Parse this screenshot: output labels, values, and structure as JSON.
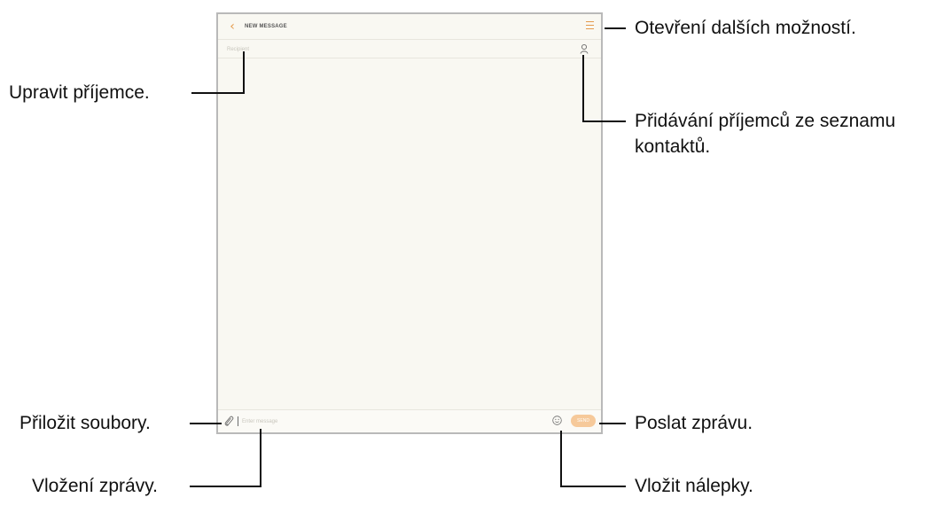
{
  "app": {
    "title": "NEW MESSAGE",
    "recipient_placeholder": "Recipient",
    "message_placeholder": "Enter message",
    "send_label": "SEND",
    "accent_color": "#e49a4c",
    "send_color": "#f6c99a"
  },
  "icons": {
    "back": "chevron-left",
    "more": "more-options",
    "contacts": "person",
    "attach": "paperclip",
    "sticker": "smiley"
  },
  "callouts": {
    "more_options": "Otevření dalších možností.",
    "edit_recipients": "Upravit příjemce.",
    "add_contacts_line1": "Přidávání příjemců ze seznamu",
    "add_contacts_line2": "kontaktů.",
    "attach_files": "Přiložit soubory.",
    "send_message": "Poslat zprávu.",
    "enter_message": "Vložení zprávy.",
    "insert_stickers": "Vložit nálepky."
  }
}
